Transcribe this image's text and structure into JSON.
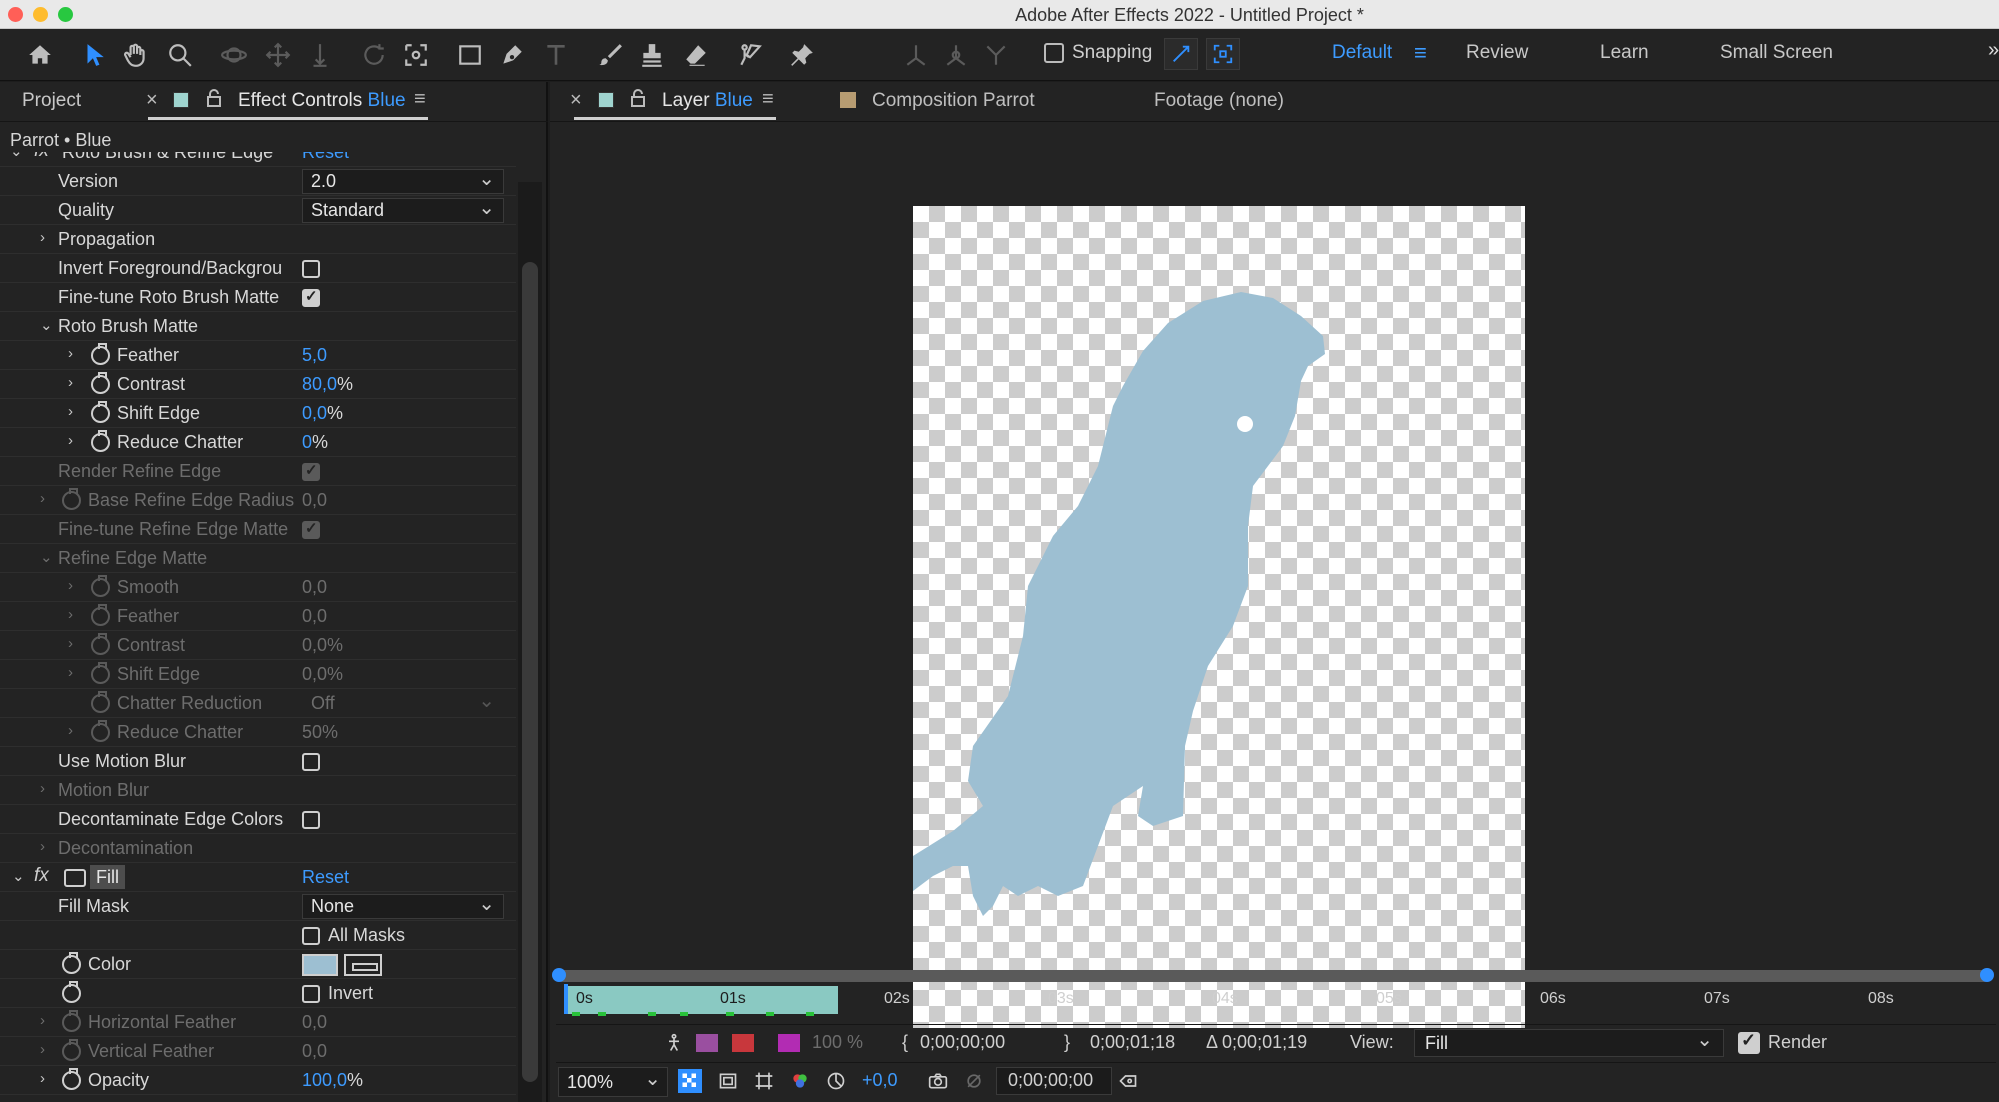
{
  "window": {
    "title": "Adobe After Effects 2022 - Untitled Project *"
  },
  "toolbar": {
    "tools": [
      "home-icon",
      "selection-tool-icon",
      "hand-tool-icon",
      "zoom-tool-icon",
      "orbit-camera-icon",
      "pan-camera-icon",
      "dolly-camera-icon",
      "rotation-tool-icon",
      "pan-behind-icon",
      "rectangle-tool-icon",
      "pen-tool-icon",
      "type-tool-icon",
      "brush-tool-icon",
      "clone-stamp-icon",
      "eraser-icon",
      "roto-brush-icon",
      "puppet-pin-icon"
    ],
    "snapping_label": "Snapping",
    "workspaces": [
      "Default",
      "Review",
      "Learn",
      "Small Screen"
    ],
    "active_workspace": "Default",
    "more": "»"
  },
  "left_panel": {
    "tab_project": "Project",
    "tab_effect_prefix": "Effect Controls",
    "tab_effect_layer": "Blue",
    "layer_path": "Parrot • Blue",
    "top_partial": {
      "label": "Roto Brush & Refine Edge",
      "reset": "Reset"
    },
    "rows": {
      "version": {
        "label": "Version",
        "value": "2.0"
      },
      "quality": {
        "label": "Quality",
        "value": "Standard"
      },
      "propagation": {
        "label": "Propagation"
      },
      "invert_fg": {
        "label": "Invert Foreground/Backgrou"
      },
      "finetune_roto": {
        "label": "Fine-tune Roto Brush Matte"
      },
      "roto_matte": {
        "label": "Roto Brush Matte"
      },
      "feather": {
        "label": "Feather",
        "num": "5,0",
        "unit": ""
      },
      "contrast": {
        "label": "Contrast",
        "num": "80,0",
        "unit": "%"
      },
      "shift_edge": {
        "label": "Shift Edge",
        "num": "0,0",
        "unit": "%"
      },
      "reduce_chatter": {
        "label": "Reduce Chatter",
        "num": "0",
        "unit": "%"
      },
      "render_refine": {
        "label": "Render Refine Edge"
      },
      "base_radius": {
        "label": "Base Refine Edge Radius",
        "value": "0,0"
      },
      "finetune_refine": {
        "label": "Fine-tune Refine Edge Matte"
      },
      "refine_matte": {
        "label": "Refine Edge Matte"
      },
      "r_smooth": {
        "label": "Smooth",
        "value": "0,0"
      },
      "r_feather": {
        "label": "Feather",
        "value": "0,0"
      },
      "r_contrast": {
        "label": "Contrast",
        "value": "0,0%"
      },
      "r_shift": {
        "label": "Shift Edge",
        "value": "0,0%"
      },
      "r_chatter_red": {
        "label": "Chatter Reduction",
        "value": "Off"
      },
      "r_reduce": {
        "label": "Reduce Chatter",
        "value": "50%"
      },
      "motion_blur_use": {
        "label": "Use Motion Blur"
      },
      "motion_blur": {
        "label": "Motion Blur"
      },
      "decontam_colors": {
        "label": "Decontaminate Edge Colors"
      },
      "decontam": {
        "label": "Decontamination"
      },
      "fill_fx": {
        "fx": "fx",
        "name": "Fill",
        "reset": "Reset"
      },
      "fill_mask": {
        "label": "Fill Mask",
        "value": "None"
      },
      "all_masks": {
        "label": "All Masks"
      },
      "color": {
        "label": "Color",
        "swatch": "#9dbfd2"
      },
      "invert": {
        "label": "Invert"
      },
      "h_feather": {
        "label": "Horizontal Feather",
        "value": "0,0"
      },
      "v_feather": {
        "label": "Vertical Feather",
        "value": "0,0"
      },
      "opacity": {
        "label": "Opacity",
        "num": "100,0",
        "unit": "%"
      }
    }
  },
  "right_panel": {
    "tab_layer_prefix": "Layer",
    "tab_layer_name": "Blue",
    "tab_comp": "Composition Parrot",
    "tab_footage": "Footage (none)",
    "matte_color": "#9dbfd2"
  },
  "timeline": {
    "ticks": [
      "0s",
      "01s",
      "02s",
      "03s",
      "04s",
      "05s",
      "06s",
      "07s",
      "08s"
    ]
  },
  "viewer_bar": {
    "opacity": "100 %",
    "in_point": "0;00;00;00",
    "out_point": "0;00;01;18",
    "duration": "Δ 0;00;01;19",
    "view_label": "View:",
    "view_value": "Fill",
    "render_label": "Render",
    "zoom": "100%",
    "exposure": "+0,0",
    "timecode": "0;00;00;00"
  }
}
